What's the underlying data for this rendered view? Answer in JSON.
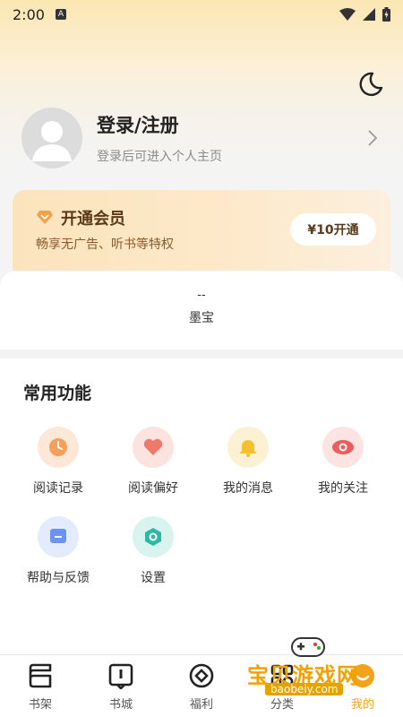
{
  "status_bar": {
    "time": "2:00",
    "notification_letter": "A"
  },
  "profile": {
    "title": "登录/注册",
    "subtitle": "登录后可进入个人主页"
  },
  "vip": {
    "title": "开通会员",
    "subtitle": "畅享无广告、听书等特权",
    "button_label": "¥10开通"
  },
  "coins": {
    "value": "--",
    "label": "墨宝"
  },
  "functions": {
    "title": "常用功能",
    "items": [
      {
        "label": "阅读记录",
        "icon": "clock-icon",
        "bg": "#fde7d6",
        "color": "#f5a05a"
      },
      {
        "label": "阅读偏好",
        "icon": "heart-icon",
        "bg": "#fde3df",
        "color": "#f07a6a"
      },
      {
        "label": "我的消息",
        "icon": "bell-icon",
        "bg": "#fdf1d3",
        "color": "#f5bf2e"
      },
      {
        "label": "我的关注",
        "icon": "eye-icon",
        "bg": "#fde3e2",
        "color": "#ee5d5d"
      },
      {
        "label": "帮助与反馈",
        "icon": "message-icon",
        "bg": "#e3ecfd",
        "color": "#6b93f2"
      },
      {
        "label": "设置",
        "icon": "settings-icon",
        "bg": "#d9f3ef",
        "color": "#2fb8a6"
      }
    ]
  },
  "bottom_nav": {
    "items": [
      {
        "label": "书架",
        "icon": "bookshelf-icon"
      },
      {
        "label": "书城",
        "icon": "bookstore-icon"
      },
      {
        "label": "福利",
        "icon": "welfare-icon"
      },
      {
        "label": "分类",
        "icon": "category-icon"
      },
      {
        "label": "我的",
        "icon": "profile-icon"
      }
    ],
    "active_index": 4
  },
  "watermark": {
    "text": "宝贝游戏网",
    "url": "baobeiy.com"
  },
  "colors": {
    "accent": "#f3a21b",
    "vip_text": "#5a3a1a"
  }
}
